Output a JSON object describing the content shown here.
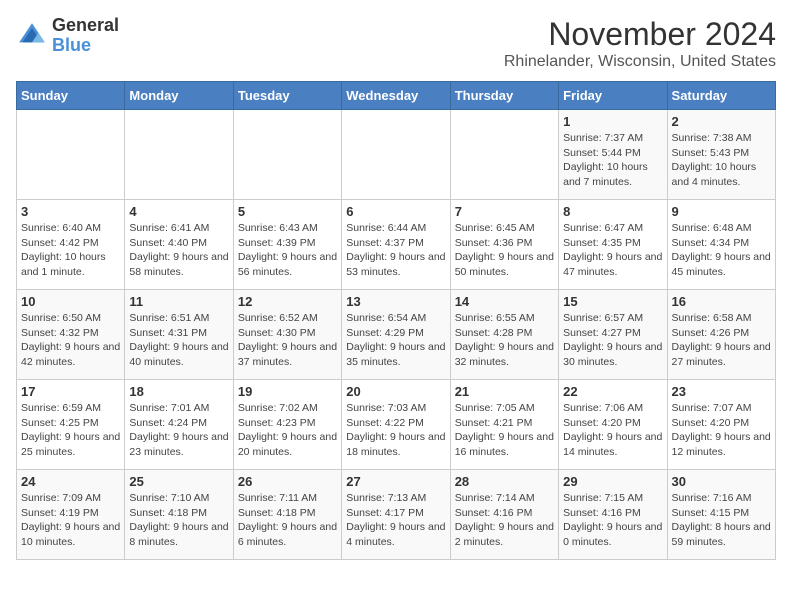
{
  "logo": {
    "general": "General",
    "blue": "Blue"
  },
  "title": "November 2024",
  "subtitle": "Rhinelander, Wisconsin, United States",
  "headers": [
    "Sunday",
    "Monday",
    "Tuesday",
    "Wednesday",
    "Thursday",
    "Friday",
    "Saturday"
  ],
  "weeks": [
    [
      {
        "day": "",
        "info": ""
      },
      {
        "day": "",
        "info": ""
      },
      {
        "day": "",
        "info": ""
      },
      {
        "day": "",
        "info": ""
      },
      {
        "day": "",
        "info": ""
      },
      {
        "day": "1",
        "info": "Sunrise: 7:37 AM\nSunset: 5:44 PM\nDaylight: 10 hours and 7 minutes."
      },
      {
        "day": "2",
        "info": "Sunrise: 7:38 AM\nSunset: 5:43 PM\nDaylight: 10 hours and 4 minutes."
      }
    ],
    [
      {
        "day": "3",
        "info": "Sunrise: 6:40 AM\nSunset: 4:42 PM\nDaylight: 10 hours and 1 minute."
      },
      {
        "day": "4",
        "info": "Sunrise: 6:41 AM\nSunset: 4:40 PM\nDaylight: 9 hours and 58 minutes."
      },
      {
        "day": "5",
        "info": "Sunrise: 6:43 AM\nSunset: 4:39 PM\nDaylight: 9 hours and 56 minutes."
      },
      {
        "day": "6",
        "info": "Sunrise: 6:44 AM\nSunset: 4:37 PM\nDaylight: 9 hours and 53 minutes."
      },
      {
        "day": "7",
        "info": "Sunrise: 6:45 AM\nSunset: 4:36 PM\nDaylight: 9 hours and 50 minutes."
      },
      {
        "day": "8",
        "info": "Sunrise: 6:47 AM\nSunset: 4:35 PM\nDaylight: 9 hours and 47 minutes."
      },
      {
        "day": "9",
        "info": "Sunrise: 6:48 AM\nSunset: 4:34 PM\nDaylight: 9 hours and 45 minutes."
      }
    ],
    [
      {
        "day": "10",
        "info": "Sunrise: 6:50 AM\nSunset: 4:32 PM\nDaylight: 9 hours and 42 minutes."
      },
      {
        "day": "11",
        "info": "Sunrise: 6:51 AM\nSunset: 4:31 PM\nDaylight: 9 hours and 40 minutes."
      },
      {
        "day": "12",
        "info": "Sunrise: 6:52 AM\nSunset: 4:30 PM\nDaylight: 9 hours and 37 minutes."
      },
      {
        "day": "13",
        "info": "Sunrise: 6:54 AM\nSunset: 4:29 PM\nDaylight: 9 hours and 35 minutes."
      },
      {
        "day": "14",
        "info": "Sunrise: 6:55 AM\nSunset: 4:28 PM\nDaylight: 9 hours and 32 minutes."
      },
      {
        "day": "15",
        "info": "Sunrise: 6:57 AM\nSunset: 4:27 PM\nDaylight: 9 hours and 30 minutes."
      },
      {
        "day": "16",
        "info": "Sunrise: 6:58 AM\nSunset: 4:26 PM\nDaylight: 9 hours and 27 minutes."
      }
    ],
    [
      {
        "day": "17",
        "info": "Sunrise: 6:59 AM\nSunset: 4:25 PM\nDaylight: 9 hours and 25 minutes."
      },
      {
        "day": "18",
        "info": "Sunrise: 7:01 AM\nSunset: 4:24 PM\nDaylight: 9 hours and 23 minutes."
      },
      {
        "day": "19",
        "info": "Sunrise: 7:02 AM\nSunset: 4:23 PM\nDaylight: 9 hours and 20 minutes."
      },
      {
        "day": "20",
        "info": "Sunrise: 7:03 AM\nSunset: 4:22 PM\nDaylight: 9 hours and 18 minutes."
      },
      {
        "day": "21",
        "info": "Sunrise: 7:05 AM\nSunset: 4:21 PM\nDaylight: 9 hours and 16 minutes."
      },
      {
        "day": "22",
        "info": "Sunrise: 7:06 AM\nSunset: 4:20 PM\nDaylight: 9 hours and 14 minutes."
      },
      {
        "day": "23",
        "info": "Sunrise: 7:07 AM\nSunset: 4:20 PM\nDaylight: 9 hours and 12 minutes."
      }
    ],
    [
      {
        "day": "24",
        "info": "Sunrise: 7:09 AM\nSunset: 4:19 PM\nDaylight: 9 hours and 10 minutes."
      },
      {
        "day": "25",
        "info": "Sunrise: 7:10 AM\nSunset: 4:18 PM\nDaylight: 9 hours and 8 minutes."
      },
      {
        "day": "26",
        "info": "Sunrise: 7:11 AM\nSunset: 4:18 PM\nDaylight: 9 hours and 6 minutes."
      },
      {
        "day": "27",
        "info": "Sunrise: 7:13 AM\nSunset: 4:17 PM\nDaylight: 9 hours and 4 minutes."
      },
      {
        "day": "28",
        "info": "Sunrise: 7:14 AM\nSunset: 4:16 PM\nDaylight: 9 hours and 2 minutes."
      },
      {
        "day": "29",
        "info": "Sunrise: 7:15 AM\nSunset: 4:16 PM\nDaylight: 9 hours and 0 minutes."
      },
      {
        "day": "30",
        "info": "Sunrise: 7:16 AM\nSunset: 4:15 PM\nDaylight: 8 hours and 59 minutes."
      }
    ]
  ]
}
